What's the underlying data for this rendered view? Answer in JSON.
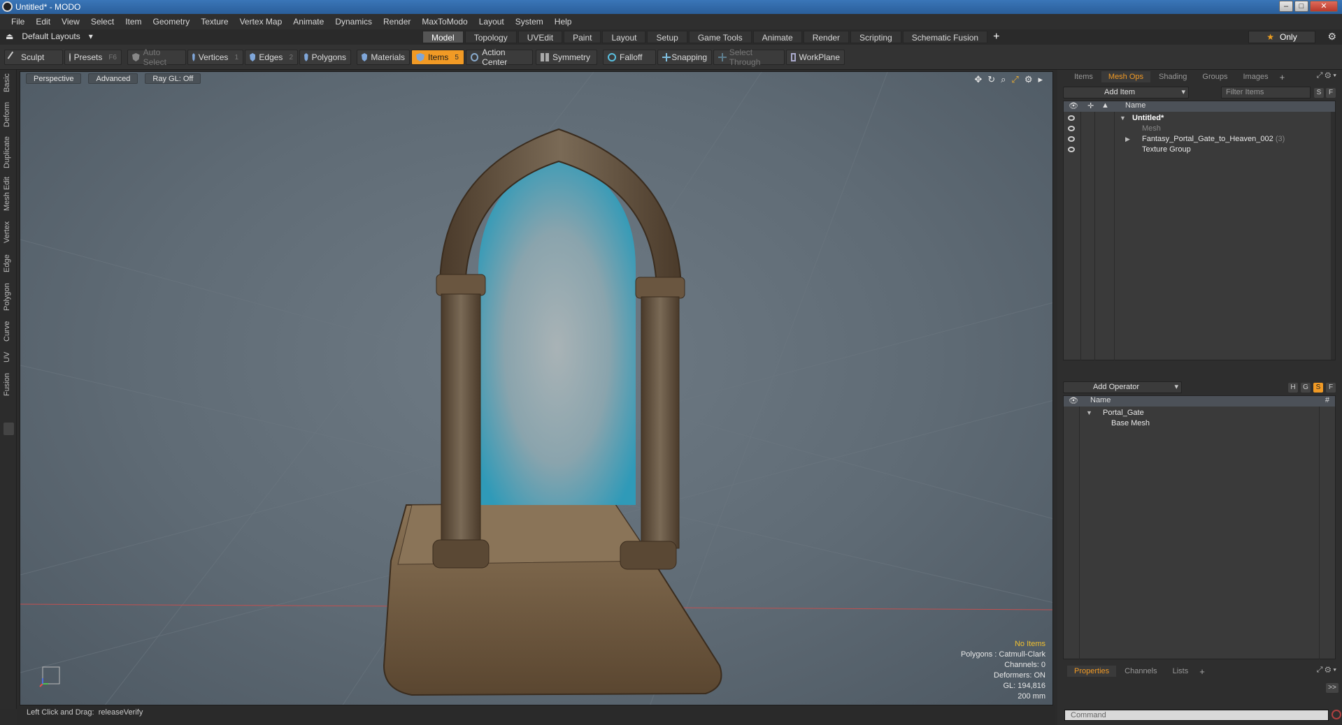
{
  "window": {
    "title": "Untitled* - MODO"
  },
  "menu": [
    "File",
    "Edit",
    "View",
    "Select",
    "Item",
    "Geometry",
    "Texture",
    "Vertex Map",
    "Animate",
    "Dynamics",
    "Render",
    "MaxToModo",
    "Layout",
    "System",
    "Help"
  ],
  "layout_selector": "Default Layouts",
  "tabs": [
    "Model",
    "Topology",
    "UVEdit",
    "Paint",
    "Layout",
    "Setup",
    "Game Tools",
    "Animate",
    "Render",
    "Scripting",
    "Schematic Fusion"
  ],
  "active_tab": "Model",
  "only_label": "Only",
  "toolbar": {
    "sculpt": "Sculpt",
    "presets": "Presets",
    "presets_key": "F6",
    "auto_select": "Auto Select",
    "vertices": "Vertices",
    "vertices_key": "1",
    "edges": "Edges",
    "edges_key": "2",
    "polygons": "Polygons",
    "materials": "Materials",
    "items": "Items",
    "items_key": "5",
    "action_center": "Action Center",
    "symmetry": "Symmetry",
    "falloff": "Falloff",
    "snapping": "Snapping",
    "select_through": "Select Through",
    "workplane": "WorkPlane"
  },
  "left_tabs": [
    "Basic",
    "Deform",
    "Duplicate",
    "Mesh Edit",
    "Vertex",
    "Edge",
    "Polygon",
    "Curve",
    "UV",
    "Fusion"
  ],
  "viewport": {
    "perspective": "Perspective",
    "advanced": "Advanced",
    "raygl": "Ray GL: Off",
    "info": {
      "no_items": "No Items",
      "polygons": "Polygons : Catmull-Clark",
      "channels": "Channels: 0",
      "deformers": "Deformers: ON",
      "gl": "GL: 194,816",
      "scale": "200 mm"
    }
  },
  "status": {
    "hint": "Left Click and Drag:",
    "value": "releaseVerify"
  },
  "items_panel": {
    "tabs": [
      "Items",
      "Mesh Ops",
      "Shading",
      "Groups",
      "Images"
    ],
    "active_tab": "Mesh Ops",
    "add_item": "Add Item",
    "filter_placeholder": "Filter Items",
    "btn_s": "S",
    "btn_f": "F",
    "name_header": "Name",
    "rows": [
      {
        "name": "Untitled*"
      },
      {
        "name": "Mesh"
      },
      {
        "name": "Fantasy_Portal_Gate_to_Heaven_002",
        "count": "(3)"
      },
      {
        "name": "Texture Group"
      }
    ]
  },
  "meshops_panel": {
    "add_operator": "Add Operator",
    "btns": [
      "H",
      "G",
      "S",
      "F"
    ],
    "name_header": "Name",
    "hash_header": "#",
    "rows": [
      {
        "name": "Portal_Gate"
      },
      {
        "name": "Base Mesh"
      }
    ]
  },
  "properties_panel": {
    "tabs": [
      "Properties",
      "Channels",
      "Lists"
    ],
    "active_tab": "Properties",
    "expand": ">>"
  },
  "command": {
    "placeholder": "Command"
  }
}
